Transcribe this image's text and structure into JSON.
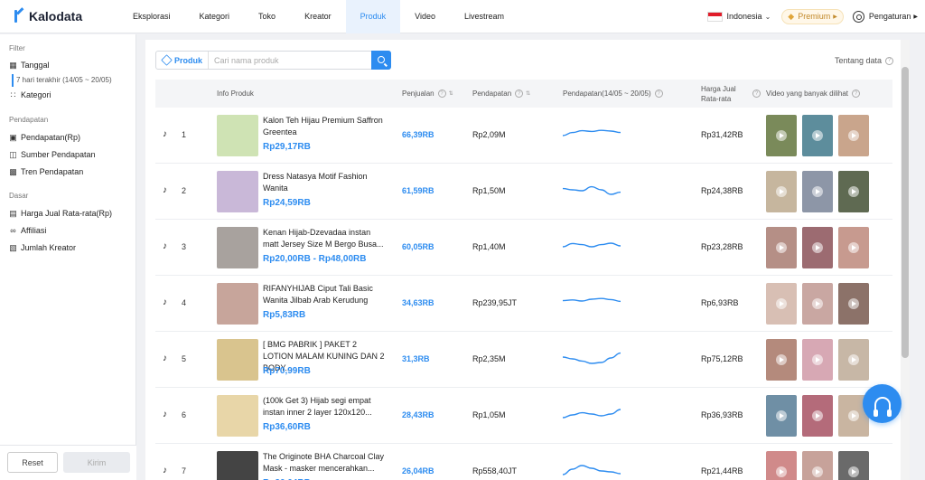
{
  "brand": {
    "name": "Kalodata"
  },
  "nav": [
    {
      "label": "Eksplorasi",
      "active": false
    },
    {
      "label": "Kategori",
      "active": false
    },
    {
      "label": "Toko",
      "active": false
    },
    {
      "label": "Kreator",
      "active": false
    },
    {
      "label": "Produk",
      "active": true
    },
    {
      "label": "Video",
      "active": false
    },
    {
      "label": "Livestream",
      "active": false
    }
  ],
  "topright": {
    "country": "Indonesia",
    "premium": "Premium",
    "settings": "Pengaturan"
  },
  "sidebar": {
    "filter_title": "Filter",
    "tanggal": "Tanggal",
    "tanggal_value": "7 hari terakhir (14/05 ~ 20/05)",
    "kategori": "Kategori",
    "pendapatan_title": "Pendapatan",
    "pendapatan_items": [
      "Pendapatan(Rp)",
      "Sumber Pendapatan",
      "Tren Pendapatan"
    ],
    "dasar_title": "Dasar",
    "dasar_items": [
      "Harga Jual Rata-rata(Rp)",
      "Affiliasi",
      "Jumlah Kreator"
    ],
    "reset": "Reset",
    "kirim": "Kirim"
  },
  "search": {
    "type_label": "Produk",
    "placeholder": "Cari nama produk",
    "value": ""
  },
  "about_label": "Tentang data",
  "table": {
    "headers": {
      "info": "Info Produk",
      "sales": "Penjualan",
      "revenue": "Pendapatan",
      "revenue_trend": "Pendapatan(14/05 ~ 20/05)",
      "avg_price": "Harga Jual Rata-rata",
      "videos": "Video yang banyak dilihat"
    },
    "rows": [
      {
        "rank": "1",
        "name": "Kalon Teh Hijau Premium Saffron Greentea",
        "price": "Rp29,17RB",
        "sales": "66,39RB",
        "revenue": "Rp2,09M",
        "avg_price": "Rp31,42RB",
        "trend": [
          0.45,
          0.62,
          0.72,
          0.68,
          0.74,
          0.7,
          0.62
        ],
        "thumb_color": "#cfe3b4",
        "vid_colors": [
          "#7a8a5a",
          "#5d8d9c",
          "#c9a58c"
        ]
      },
      {
        "rank": "2",
        "name": "Dress Natasya Motif Fashion Wanita",
        "price": "Rp24,59RB",
        "sales": "61,59RB",
        "revenue": "Rp1,50M",
        "avg_price": "Rp24,38RB",
        "trend": [
          0.62,
          0.55,
          0.5,
          0.72,
          0.55,
          0.3,
          0.42
        ],
        "thumb_color": "#c9b8d8",
        "vid_colors": [
          "#c6b69e",
          "#8d96a7",
          "#5f6a52"
        ]
      },
      {
        "rank": "3",
        "name": "Kenan Hijab-Dzevadaa instan matt Jersey Size M Bergo Busa...",
        "price": "Rp20,00RB - Rp48,00RB",
        "sales": "60,05RB",
        "revenue": "Rp1,40M",
        "avg_price": "Rp23,28RB",
        "trend": [
          0.5,
          0.68,
          0.62,
          0.5,
          0.62,
          0.7,
          0.55
        ],
        "thumb_color": "#a8a29e",
        "vid_colors": [
          "#b58f86",
          "#9c6b71",
          "#c79a8f"
        ]
      },
      {
        "rank": "4",
        "name": "RIFANYHIJAB Ciput Tali Basic Wanita Jilbab Arab Kerudung",
        "price": "Rp5,83RB",
        "sales": "34,63RB",
        "revenue": "Rp239,95JT",
        "avg_price": "Rp6,93RB",
        "trend": [
          0.62,
          0.66,
          0.6,
          0.7,
          0.74,
          0.68,
          0.58
        ],
        "thumb_color": "#c7a59b",
        "vid_colors": [
          "#d8bfb4",
          "#c9a7a2",
          "#8c7269"
        ]
      },
      {
        "rank": "5",
        "name": "[ BMG PABRIK ] PAKET 2 LOTION MALAM KUNING DAN 2 BODY...",
        "price": "Rp70,99RB",
        "sales": "31,3RB",
        "revenue": "Rp2,35M",
        "avg_price": "Rp75,12RB",
        "trend": [
          0.6,
          0.5,
          0.38,
          0.25,
          0.3,
          0.55,
          0.82
        ],
        "thumb_color": "#d9c48e",
        "vid_colors": [
          "#b48a7c",
          "#d7a8b4",
          "#c7b7a6"
        ]
      },
      {
        "rank": "6",
        "name": "(100k Get 3) Hijab segi empat instan inner 2 layer 120x120...",
        "price": "Rp36,60RB",
        "sales": "28,43RB",
        "revenue": "Rp1,05M",
        "avg_price": "Rp36,93RB",
        "trend": [
          0.35,
          0.5,
          0.62,
          0.55,
          0.45,
          0.55,
          0.8
        ],
        "thumb_color": "#e8d6a8",
        "vid_colors": [
          "#6f8fa5",
          "#b46b7a",
          "#c9b5a1"
        ]
      },
      {
        "rank": "7",
        "name": "The Originote BHA Charcoal Clay Mask - masker mencerahkan...",
        "price": "Rp26,04RB",
        "sales": "26,04RB",
        "revenue": "Rp558,40JT",
        "avg_price": "Rp21,44RB",
        "trend": [
          0.3,
          0.6,
          0.8,
          0.65,
          0.5,
          0.45,
          0.35
        ],
        "thumb_color": "#444444",
        "vid_colors": [
          "#d08a8a",
          "#c7a29a",
          "#6a6a6a"
        ]
      }
    ]
  },
  "colors": {
    "accent": "#2d8cf0",
    "price": "#2d8cf0"
  }
}
